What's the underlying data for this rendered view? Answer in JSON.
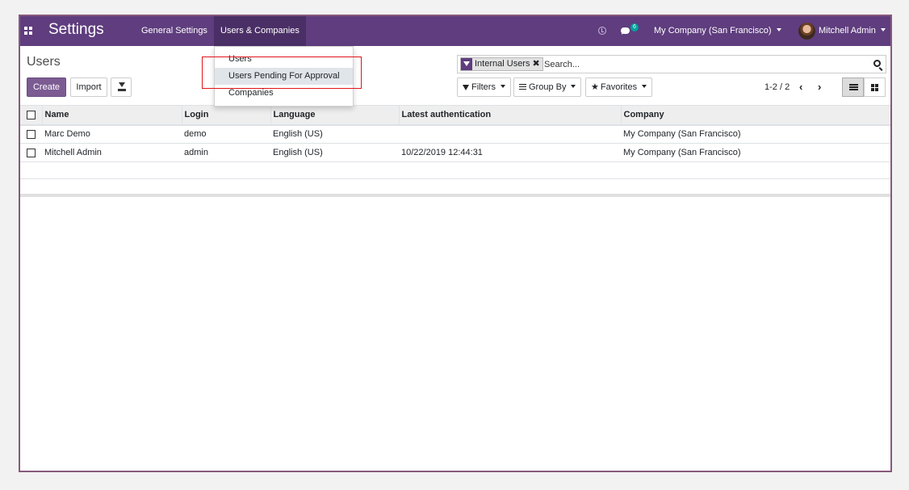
{
  "navbar": {
    "app_title": "Settings",
    "menus": [
      "General Settings",
      "Users & Companies"
    ],
    "chat_badge": "6",
    "company": "My Company (San Francisco)",
    "user": "Mitchell Admin"
  },
  "dropdown": {
    "items": [
      "Users",
      "Users Pending For Approval",
      "Companies"
    ]
  },
  "control_panel": {
    "breadcrumb": "Users",
    "create_label": "Create",
    "import_label": "Import",
    "facet_label": "Internal Users",
    "facet_remove": "✖",
    "search_placeholder": "Search...",
    "filters_label": "Filters",
    "groupby_label": "Group By",
    "favorites_label": "Favorites",
    "pager": "1-2 / 2",
    "pager_prev": "‹",
    "pager_next": "›"
  },
  "table": {
    "columns": [
      "Name",
      "Login",
      "Language",
      "Latest authentication",
      "Company"
    ],
    "rows": [
      [
        "Marc Demo",
        "demo",
        "English (US)",
        "",
        "My Company (San Francisco)"
      ],
      [
        "Mitchell Admin",
        "admin",
        "English (US)",
        "10/22/2019 12:44:31",
        "My Company (San Francisco)"
      ]
    ]
  },
  "colors": {
    "navbar": "#5f3d7e",
    "primary": "#7c5b93",
    "frame": "#875a7b",
    "highlight": "#e1141b"
  }
}
